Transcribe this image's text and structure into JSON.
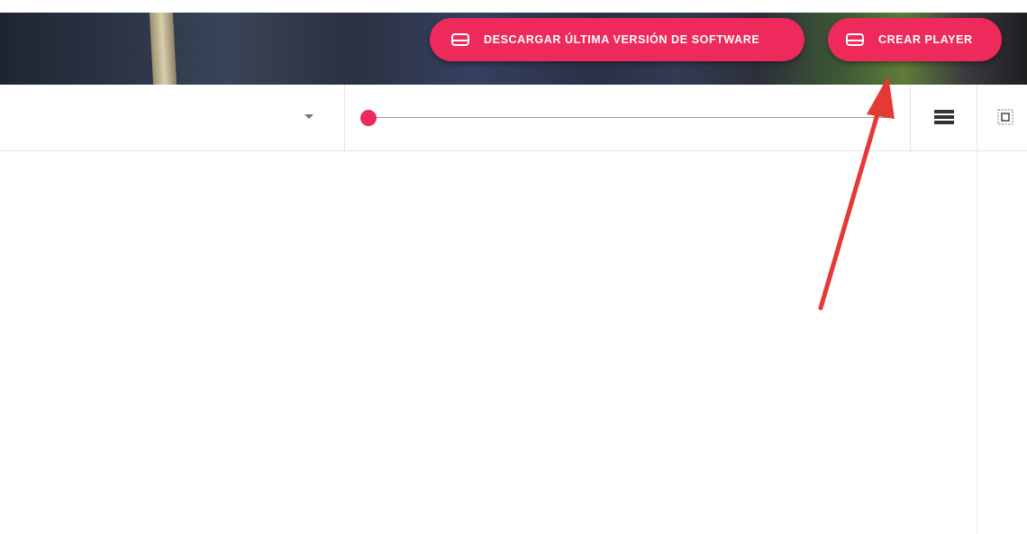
{
  "header": {
    "buttons": {
      "download_label": "DESCARGAR ÚLTIMA VERSIÓN DE SOFTWARE",
      "create_label": "CREAR PLAYER"
    },
    "icons": {
      "download": "drive-icon",
      "create": "drive-icon"
    }
  },
  "toolbar": {
    "dropdown": {
      "value": ""
    },
    "slider": {
      "value_fraction": 0.0
    },
    "views": [
      "list-view-icon",
      "grid-view-icon"
    ]
  },
  "colors": {
    "accent": "#ee2a5c",
    "annotation_arrow": "#e53935"
  }
}
